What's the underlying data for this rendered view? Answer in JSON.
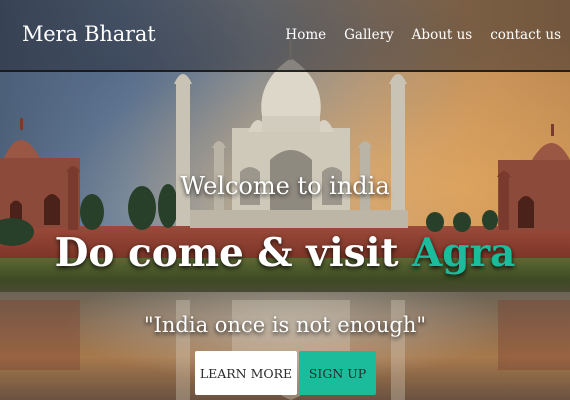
{
  "brand": {
    "name": "Mera Bharat"
  },
  "nav": {
    "items": [
      {
        "label": "Home"
      },
      {
        "label": "Gallery"
      },
      {
        "label": "About us"
      },
      {
        "label": "contact us"
      }
    ]
  },
  "hero": {
    "welcome": "Welcome to india",
    "headline_prefix": "Do come & visit ",
    "headline_accent": "Agra",
    "tagline": "\"India once is not enough\"",
    "learn_more_label": "LEARN MORE",
    "sign_up_label": "SIGN UP"
  },
  "colors": {
    "accent": "#1abc9c",
    "nav_background": "rgba(30,32,40,0.45)",
    "text": "#ffffff"
  },
  "background": {
    "subject": "taj-mahal-at-dusk",
    "icon": "landscape-photo-icon"
  }
}
